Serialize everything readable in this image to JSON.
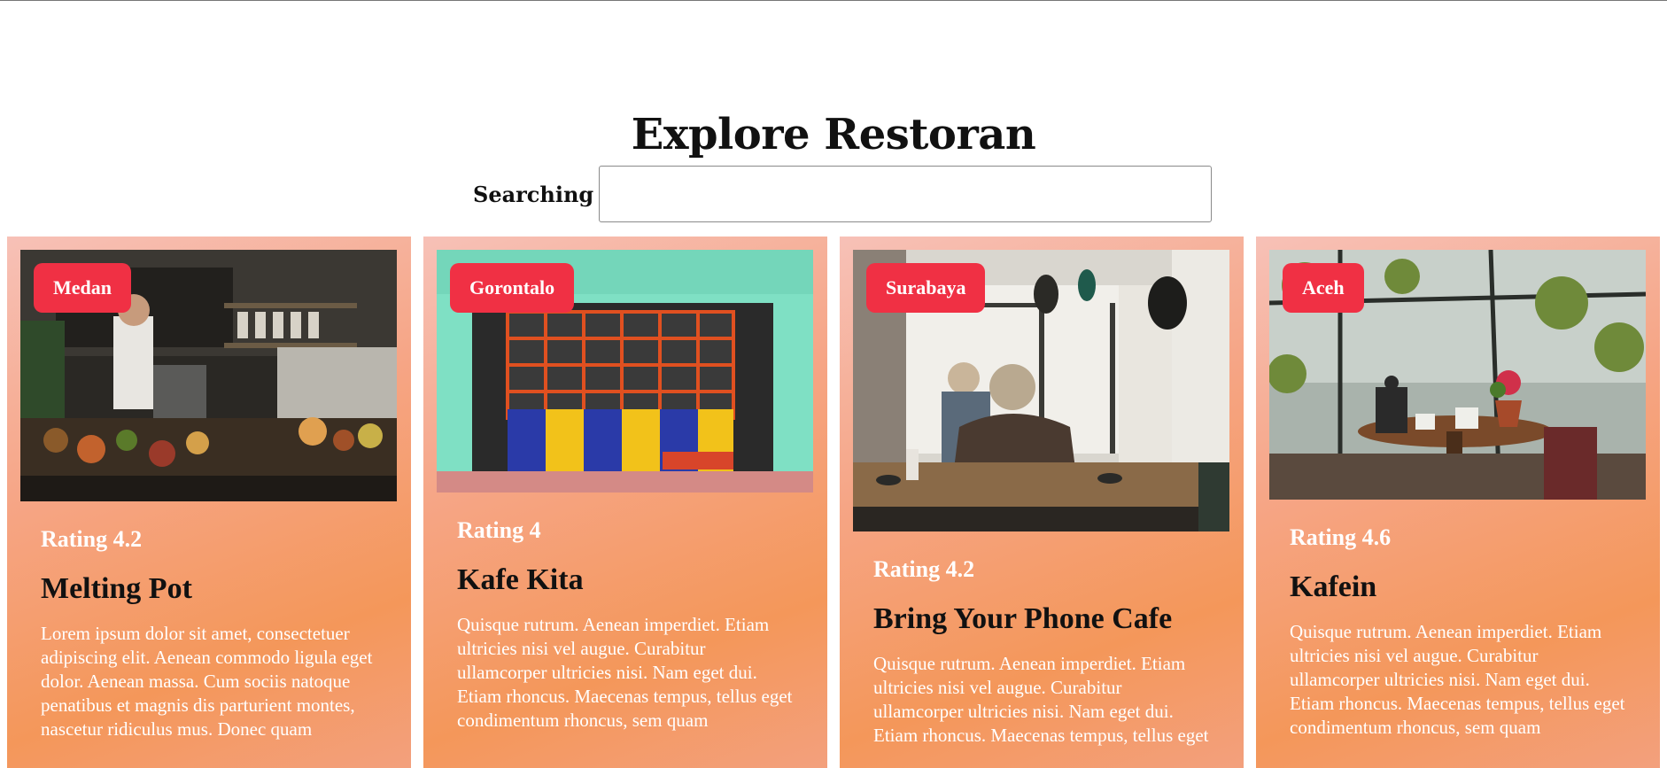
{
  "page": {
    "title": "Explore Restoran"
  },
  "search": {
    "label": "Searching",
    "value": "",
    "placeholder": ""
  },
  "restaurants": [
    {
      "city": "Medan",
      "rating": "Rating 4.2",
      "name": "Melting Pot",
      "description": "Lorem ipsum dolor sit amet, consectetuer adipiscing elit. Aenean commodo ligula eget dolor. Aenean massa. Cum sociis natoque penatibus et magnis dis parturient montes, nascetur ridiculus mus. Donec quam"
    },
    {
      "city": "Gorontalo",
      "rating": "Rating 4",
      "name": "Kafe Kita",
      "description": "Quisque rutrum. Aenean imperdiet. Etiam ultricies nisi vel augue. Curabitur ullamcorper ultricies nisi. Nam eget dui. Etiam rhoncus. Maecenas tempus, tellus eget condimentum rhoncus, sem quam"
    },
    {
      "city": "Surabaya",
      "rating": "Rating 4.2",
      "name": "Bring Your Phone Cafe",
      "description": "Quisque rutrum. Aenean imperdiet. Etiam ultricies nisi vel augue. Curabitur ullamcorper ultricies nisi. Nam eget dui. Etiam rhoncus. Maecenas tempus, tellus eget"
    },
    {
      "city": "Aceh",
      "rating": "Rating 4.6",
      "name": "Kafein",
      "description": "Quisque rutrum. Aenean imperdiet. Etiam ultricies nisi vel augue. Curabitur ullamcorper ultricies nisi. Nam eget dui. Etiam rhoncus. Maecenas tempus, tellus eget condimentum rhoncus, sem quam"
    }
  ],
  "colors": {
    "badge": "#f03044",
    "card_gradient_start": "#f7c1b7",
    "card_gradient_end": "#f4975a"
  }
}
